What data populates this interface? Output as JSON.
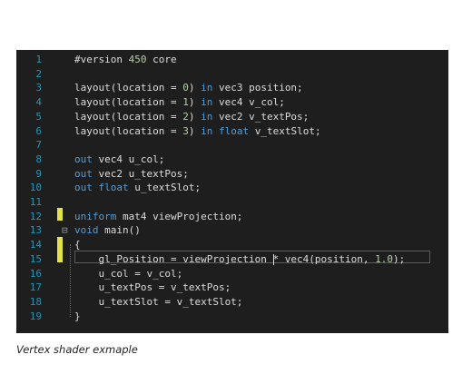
{
  "editor": {
    "lines": [
      {
        "n": "1",
        "segs": [
          [
            "plain",
            "#version "
          ],
          [
            "num",
            "450"
          ],
          [
            "plain",
            " core"
          ]
        ]
      },
      {
        "n": "2",
        "segs": []
      },
      {
        "n": "3",
        "segs": [
          [
            "plain",
            "layout(location = "
          ],
          [
            "num",
            "0"
          ],
          [
            "plain",
            ") "
          ],
          [
            "kw",
            "in"
          ],
          [
            "plain",
            " vec3 position;"
          ]
        ]
      },
      {
        "n": "4",
        "segs": [
          [
            "plain",
            "layout(location = "
          ],
          [
            "num",
            "1"
          ],
          [
            "plain",
            ") "
          ],
          [
            "kw",
            "in"
          ],
          [
            "plain",
            " vec4 v_col;"
          ]
        ]
      },
      {
        "n": "5",
        "segs": [
          [
            "plain",
            "layout(location = "
          ],
          [
            "num",
            "2"
          ],
          [
            "plain",
            ") "
          ],
          [
            "kw",
            "in"
          ],
          [
            "plain",
            " vec2 v_textPos;"
          ]
        ]
      },
      {
        "n": "6",
        "segs": [
          [
            "plain",
            "layout(location = "
          ],
          [
            "num",
            "3"
          ],
          [
            "plain",
            ") "
          ],
          [
            "kw",
            "in"
          ],
          [
            "plain",
            " "
          ],
          [
            "kw",
            "float"
          ],
          [
            "plain",
            " v_textSlot;"
          ]
        ]
      },
      {
        "n": "7",
        "segs": []
      },
      {
        "n": "8",
        "segs": [
          [
            "kw",
            "out"
          ],
          [
            "plain",
            " vec4 u_col;"
          ]
        ]
      },
      {
        "n": "9",
        "segs": [
          [
            "kw",
            "out"
          ],
          [
            "plain",
            " vec2 u_textPos;"
          ]
        ]
      },
      {
        "n": "10",
        "segs": [
          [
            "kw",
            "out"
          ],
          [
            "plain",
            " "
          ],
          [
            "kw",
            "float"
          ],
          [
            "plain",
            " u_textSlot;"
          ]
        ]
      },
      {
        "n": "11",
        "segs": []
      },
      {
        "n": "12",
        "segs": [
          [
            "kw",
            "uniform"
          ],
          [
            "plain",
            " mat4 viewProjection;"
          ]
        ]
      },
      {
        "n": "13",
        "segs": [
          [
            "kw",
            "void"
          ],
          [
            "plain",
            " main()"
          ]
        ]
      },
      {
        "n": "14",
        "segs": [
          [
            "plain",
            "{"
          ]
        ]
      },
      {
        "n": "15",
        "segs": [
          [
            "plain",
            "    gl_Position = viewProjection * vec4(position, "
          ],
          [
            "num",
            "1.0"
          ],
          [
            "plain",
            ");"
          ]
        ]
      },
      {
        "n": "16",
        "segs": [
          [
            "plain",
            "    u_col = v_col;"
          ]
        ]
      },
      {
        "n": "17",
        "segs": [
          [
            "plain",
            "    u_textPos = v_textPos;"
          ]
        ]
      },
      {
        "n": "18",
        "segs": [
          [
            "plain",
            "    u_textSlot = v_textSlot;"
          ]
        ]
      },
      {
        "n": "19",
        "segs": [
          [
            "plain",
            "}"
          ]
        ]
      }
    ],
    "fold_icon": "collapse-minus-icon",
    "colors": {
      "background": "#1e1e1e",
      "keyword": "#569cd6",
      "number": "#b5cea8",
      "line_number": "#2b91af",
      "text": "#dcdcdc",
      "change_marker": "#e5e04d"
    }
  },
  "caption": "Vertex shader exmaple"
}
